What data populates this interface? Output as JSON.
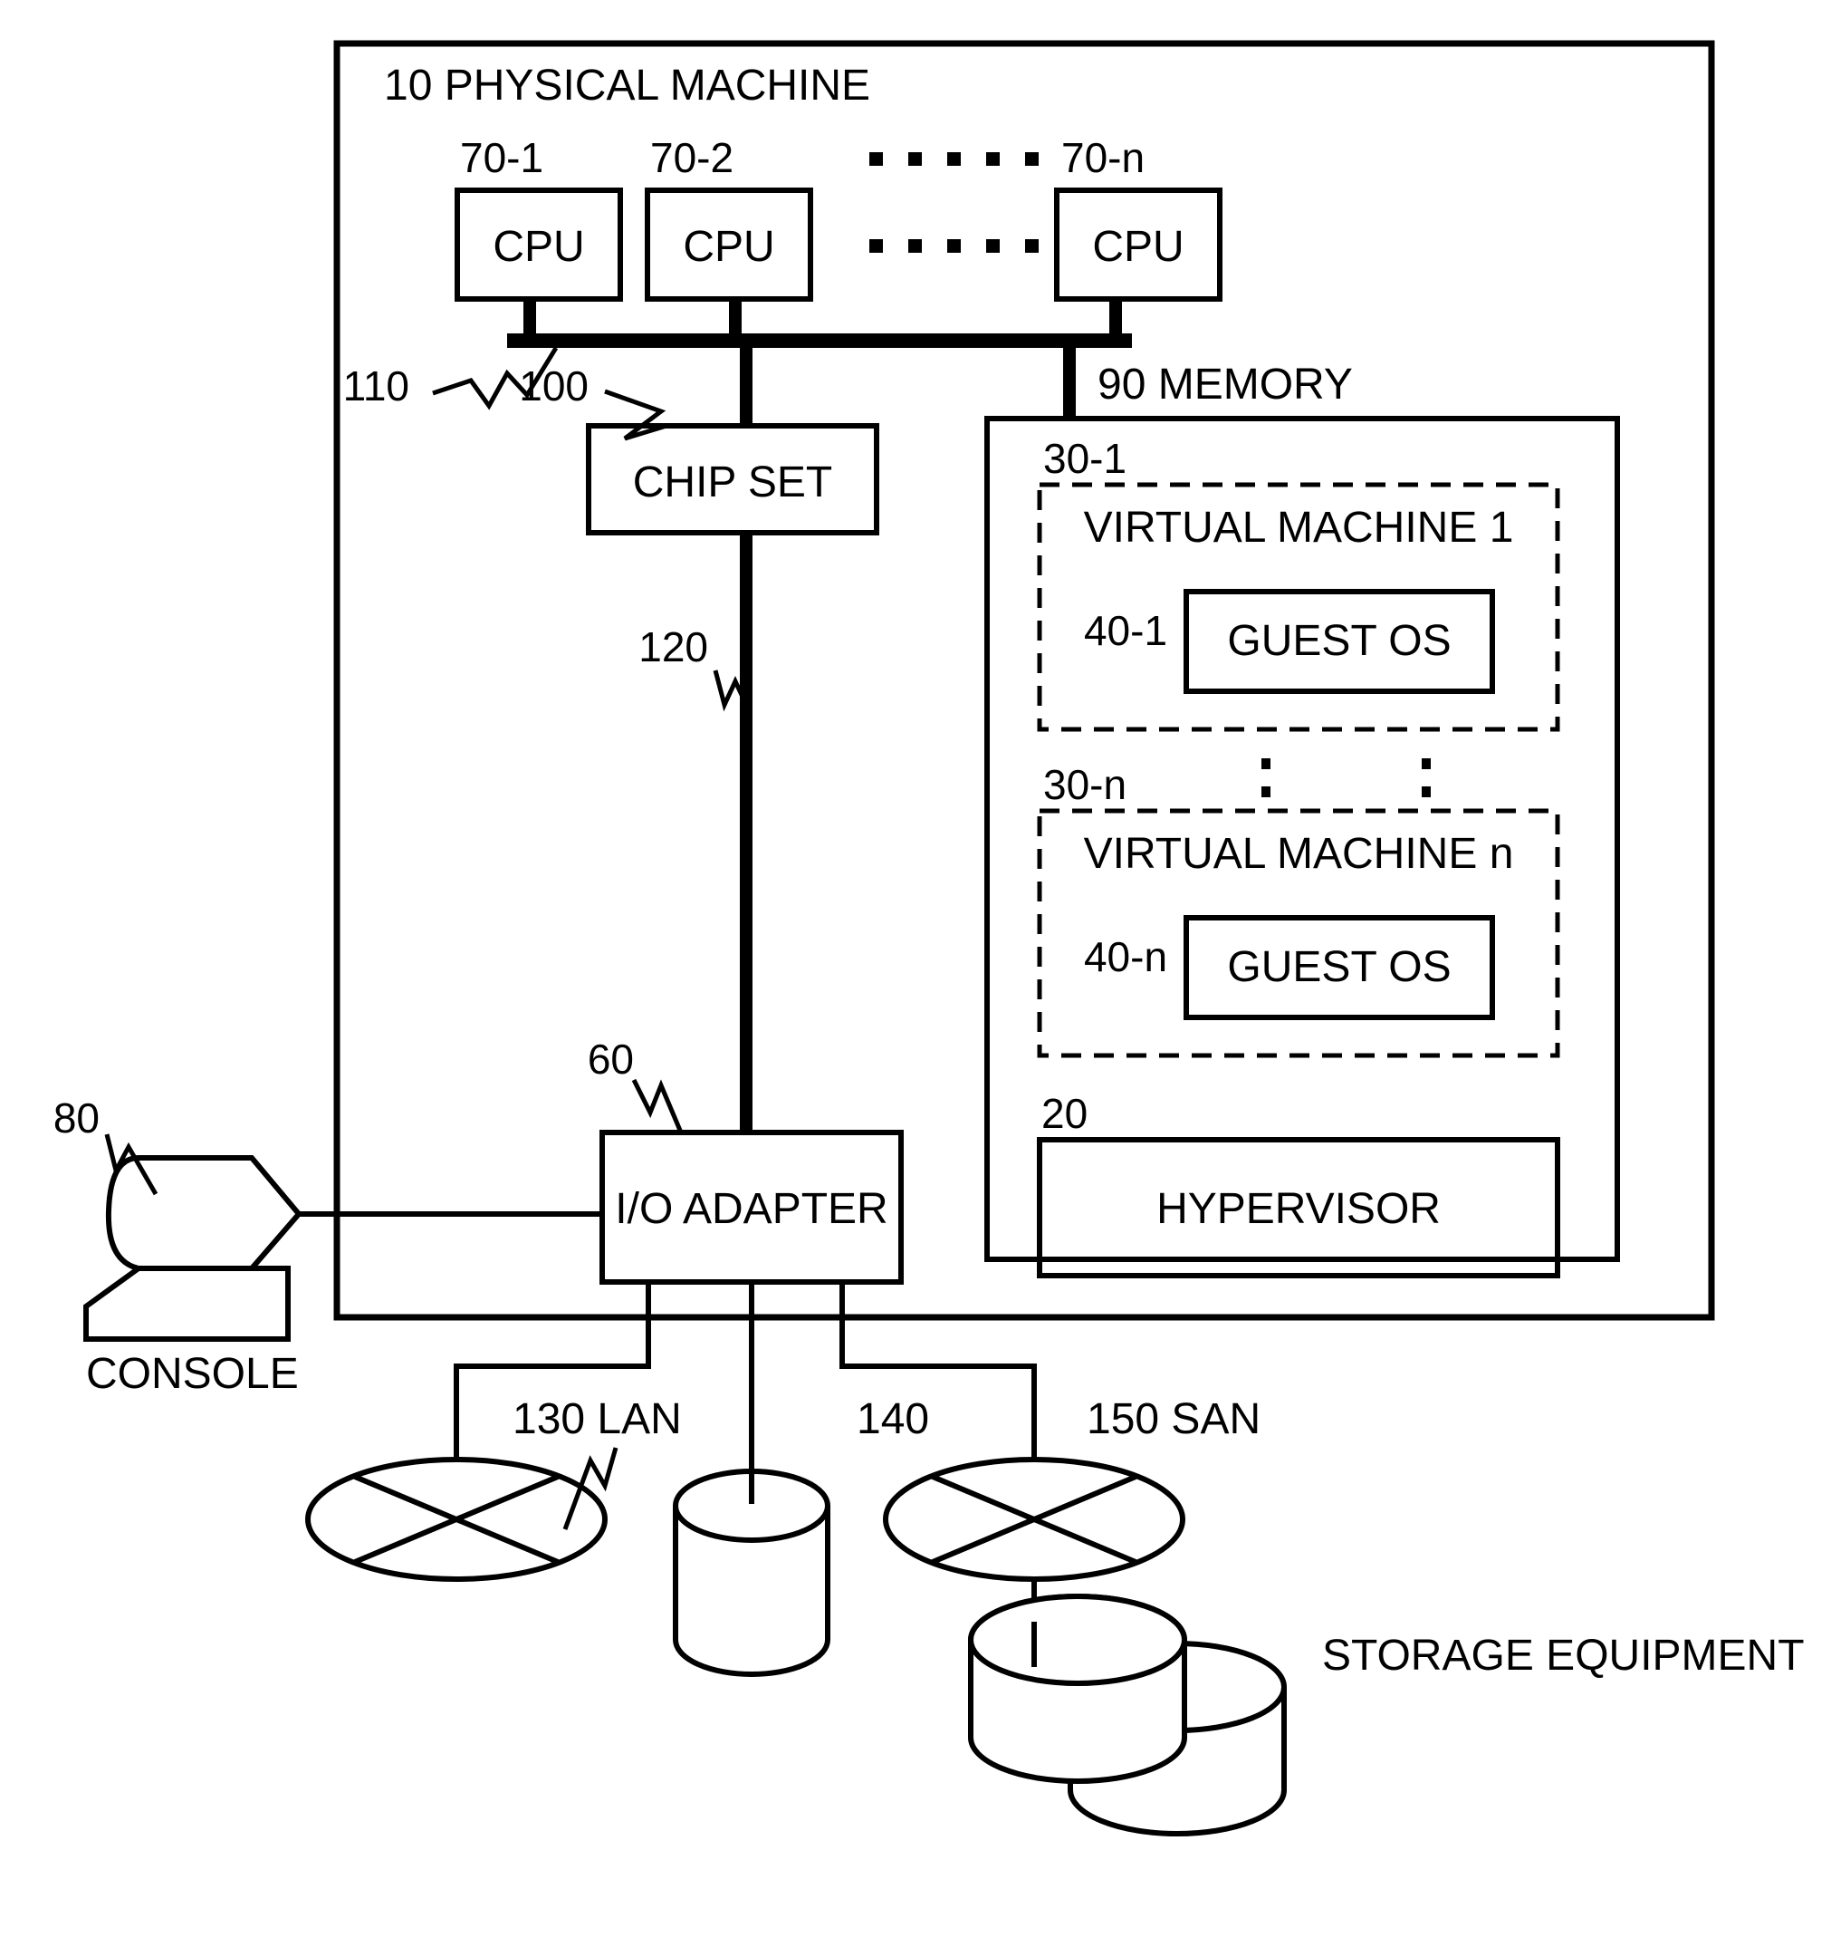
{
  "figure": {
    "type": "patent-block-diagram",
    "title_label": "10 PHYSICAL MACHINE"
  },
  "physical_machine": {
    "ref": "10",
    "label": "10 PHYSICAL MACHINE"
  },
  "cpus": [
    {
      "ref": "70-1",
      "label": "CPU"
    },
    {
      "ref": "70-2",
      "label": "CPU"
    },
    {
      "ref": "70-n",
      "label": "CPU"
    }
  ],
  "cpu_ellipsis": {
    "rows": 2,
    "dots_per_row": 5,
    "glyph": "square-dot"
  },
  "bus": {
    "ref": "110",
    "name": "system-bus"
  },
  "chipset": {
    "ref": "100",
    "label": "CHIP SET"
  },
  "io_bus": {
    "ref": "120",
    "name": "io-bus"
  },
  "io_adapter": {
    "ref": "60",
    "label": "I/O ADAPTER"
  },
  "console": {
    "ref": "80",
    "label": "CONSOLE"
  },
  "memory": {
    "ref": "90",
    "label": "90 MEMORY",
    "virtual_machines": [
      {
        "ref": "30-1",
        "label": "VIRTUAL MACHINE 1",
        "guest_os": {
          "ref": "40-1",
          "label": "GUEST OS"
        }
      },
      {
        "ref": "30-n",
        "label": "VIRTUAL MACHINE n",
        "guest_os": {
          "ref": "40-n",
          "label": "GUEST OS"
        }
      }
    ],
    "vm_ellipsis": {
      "columns": 2,
      "dots_per_column": 2,
      "glyph": "vertical-dots"
    },
    "hypervisor": {
      "ref": "20",
      "label": "HYPERVISOR"
    }
  },
  "peripherals": {
    "lan": {
      "ref": "130",
      "label": "130 LAN",
      "shape": "network-cloud-ellipse-x"
    },
    "disk": {
      "ref": "140",
      "label": "140",
      "shape": "cylinder"
    },
    "san": {
      "ref": "150",
      "label": "150 SAN",
      "shape": "network-cloud-ellipse-x"
    },
    "storage_equipment": {
      "label": "STORAGE EQUIPMENT",
      "shape": "double-cylinder"
    }
  },
  "colors": {
    "stroke": "#000000",
    "background": "#ffffff"
  }
}
